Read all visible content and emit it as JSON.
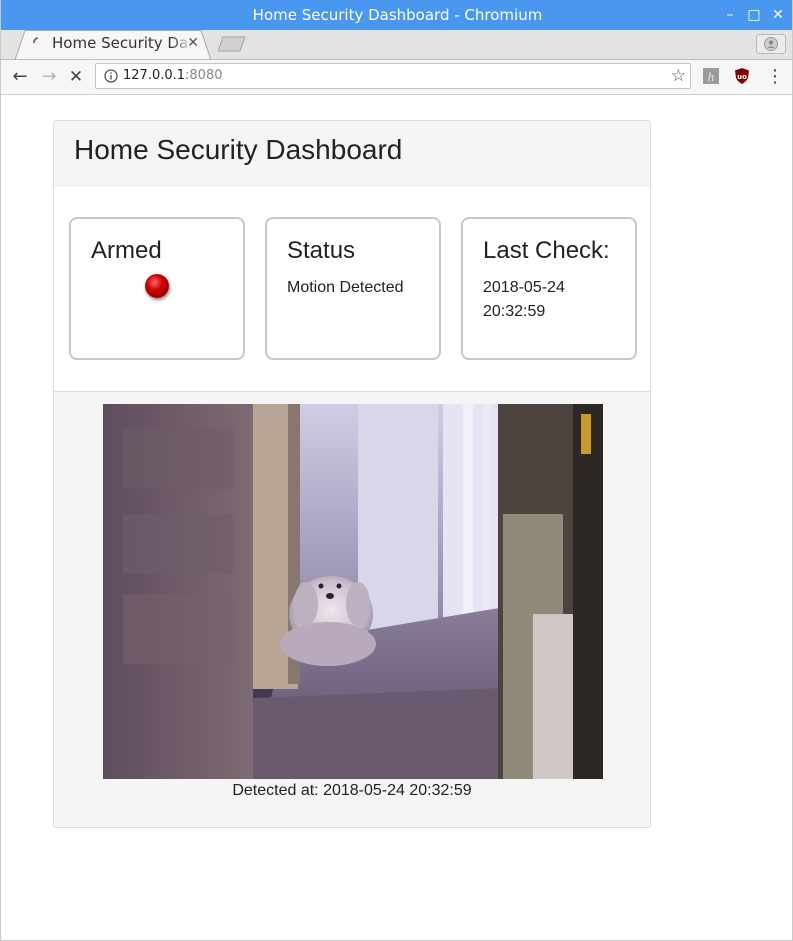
{
  "window": {
    "title": "Home Security Dashboard - Chromium",
    "controls": {
      "minimize": "–",
      "maximize": "□",
      "close": "✕"
    }
  },
  "tabs": [
    {
      "title": "Home Security Dashboard",
      "close": "✕",
      "active": true,
      "icon": "loading-spinner-icon"
    }
  ],
  "toolbar": {
    "back_icon": "←",
    "forward_icon": "→",
    "stop_icon": "✕",
    "url_host": "127.0.0.1",
    "url_port": ":8080",
    "bookmark_icon": "☆",
    "menu_icon": "⋮",
    "extensions": [
      "h-extension-icon",
      "ublock-origin-icon"
    ]
  },
  "dashboard": {
    "heading": "Home Security Dashboard",
    "cards": {
      "armed": {
        "title": "Armed",
        "indicator_color": "#c00000"
      },
      "status": {
        "title": "Status",
        "value": "Motion Detected"
      },
      "last_check": {
        "title": "Last Check:",
        "date": "2018-05-24",
        "time": "20:32:59"
      }
    },
    "snapshot": {
      "alt": "camera-snapshot",
      "caption": "Detected at: 2018-05-24 20:32:59"
    }
  },
  "colors": {
    "titlebar": "#4a97f0",
    "panel_bg": "#f5f5f5",
    "card_border": "#c8c8c8",
    "indicator_red": "#c00000"
  }
}
